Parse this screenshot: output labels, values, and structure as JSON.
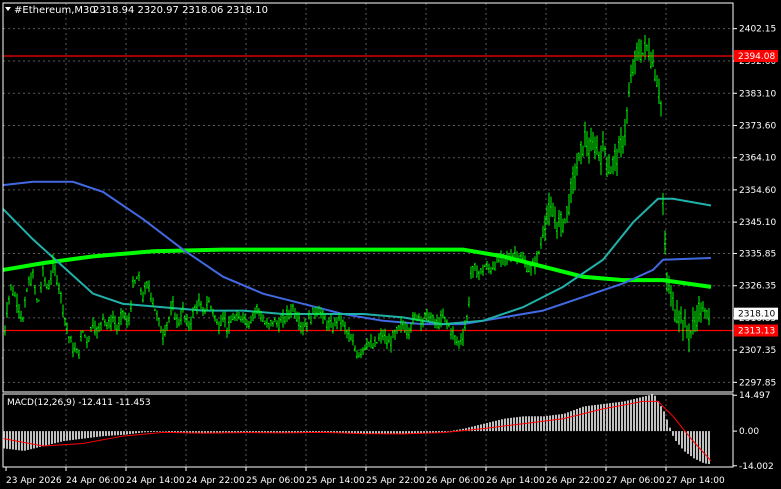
{
  "header": {
    "symbol_tf": "#Ethereum,M30",
    "ohlc": "2318.94 2320.97 2318.06 2318.10"
  },
  "macd": {
    "label": "MACD(12,26,9) -12.411 -11.453"
  },
  "colors": {
    "background": "#000000",
    "grid": "#5a5a5a",
    "candle": "#00ff00",
    "ma_slow": "#00ff00",
    "ma_blue": "#4169e1",
    "ma_teal": "#20b2aa",
    "hline": "#ff0000",
    "macd_hist": "#c0c0c0",
    "macd_signal": "#ff0000"
  },
  "chart_data": {
    "type": "candlestick",
    "symbol": "#Ethereum",
    "timeframe": "M30",
    "price_axis_ticks": [
      "2402.15",
      "2392.60",
      "2383.10",
      "2373.60",
      "2364.10",
      "2354.60",
      "2345.10",
      "2335.85",
      "2326.35",
      "2316.85",
      "2307.35",
      "2297.85"
    ],
    "price_range": [
      2295.0,
      2405.0
    ],
    "current_price": "2318.10",
    "hlines": [
      {
        "price": 2394.08,
        "label": "2394.08"
      },
      {
        "price": 2313.13,
        "label": "2313.13"
      }
    ],
    "time_axis_ticks": [
      "23 Apr 2026",
      "24 Apr 06:00",
      "24 Apr 14:00",
      "24 Apr 22:00",
      "25 Apr 06:00",
      "25 Apr 14:00",
      "25 Apr 22:00",
      "26 Apr 06:00",
      "26 Apr 14:00",
      "26 Apr 22:00",
      "27 Apr 06:00",
      "27 Apr 14:00"
    ],
    "price_series": [
      [
        0,
        2305
      ],
      [
        3,
        2318
      ],
      [
        8,
        2326
      ],
      [
        14,
        2322
      ],
      [
        20,
        2316
      ],
      [
        25,
        2327
      ],
      [
        30,
        2329
      ],
      [
        35,
        2320
      ],
      [
        40,
        2330
      ],
      [
        45,
        2325
      ],
      [
        50,
        2332
      ],
      [
        55,
        2328
      ],
      [
        60,
        2320
      ],
      [
        65,
        2312
      ],
      [
        70,
        2308
      ],
      [
        75,
        2306
      ],
      [
        80,
        2313
      ],
      [
        85,
        2310
      ],
      [
        90,
        2316
      ],
      [
        95,
        2312
      ],
      [
        100,
        2318
      ],
      [
        105,
        2314
      ],
      [
        110,
        2317
      ],
      [
        115,
        2313
      ],
      [
        120,
        2319
      ],
      [
        125,
        2314
      ],
      [
        130,
        2326
      ],
      [
        135,
        2329
      ],
      [
        140,
        2323
      ],
      [
        145,
        2327
      ],
      [
        150,
        2322
      ],
      [
        155,
        2316
      ],
      [
        160,
        2312
      ],
      [
        165,
        2316
      ],
      [
        170,
        2320
      ],
      [
        175,
        2315
      ],
      [
        180,
        2319
      ],
      [
        185,
        2314
      ],
      [
        190,
        2318
      ],
      [
        195,
        2322
      ],
      [
        200,
        2318
      ],
      [
        205,
        2322
      ],
      [
        210,
        2319
      ],
      [
        215,
        2314
      ],
      [
        220,
        2318
      ],
      [
        225,
        2313
      ],
      [
        230,
        2317
      ],
      [
        235,
        2316
      ],
      [
        240,
        2318
      ],
      [
        245,
        2315
      ],
      [
        250,
        2318
      ],
      [
        255,
        2320
      ],
      [
        260,
        2316
      ],
      [
        265,
        2314
      ],
      [
        270,
        2316
      ],
      [
        275,
        2315
      ],
      [
        280,
        2316
      ],
      [
        285,
        2318
      ],
      [
        290,
        2320
      ],
      [
        295,
        2317
      ],
      [
        300,
        2314
      ],
      [
        305,
        2316
      ],
      [
        310,
        2318
      ],
      [
        315,
        2320
      ],
      [
        320,
        2317
      ],
      [
        325,
        2315
      ],
      [
        330,
        2314
      ],
      [
        335,
        2317
      ],
      [
        340,
        2315
      ],
      [
        345,
        2312
      ],
      [
        350,
        2309
      ],
      [
        355,
        2306
      ],
      [
        360,
        2308
      ],
      [
        365,
        2310
      ],
      [
        370,
        2308
      ],
      [
        375,
        2310
      ],
      [
        380,
        2312
      ],
      [
        385,
        2309
      ],
      [
        390,
        2311
      ],
      [
        395,
        2313
      ],
      [
        400,
        2315
      ],
      [
        405,
        2313
      ],
      [
        410,
        2316
      ],
      [
        415,
        2318
      ],
      [
        420,
        2316
      ],
      [
        425,
        2318
      ],
      [
        430,
        2316
      ],
      [
        435,
        2315
      ],
      [
        440,
        2317
      ],
      [
        445,
        2315
      ],
      [
        450,
        2312
      ],
      [
        455,
        2309
      ],
      [
        460,
        2312
      ],
      [
        465,
        2318
      ],
      [
        468,
        2330
      ],
      [
        472,
        2331
      ],
      [
        477,
        2330
      ],
      [
        482,
        2332
      ],
      [
        487,
        2331
      ],
      [
        492,
        2333
      ],
      [
        497,
        2334
      ],
      [
        502,
        2334
      ],
      [
        507,
        2335
      ],
      [
        512,
        2336
      ],
      [
        517,
        2335
      ],
      [
        522,
        2333
      ],
      [
        527,
        2331
      ],
      [
        532,
        2333
      ],
      [
        537,
        2337
      ],
      [
        542,
        2346
      ],
      [
        547,
        2348
      ],
      [
        552,
        2346
      ],
      [
        557,
        2344
      ],
      [
        562,
        2346
      ],
      [
        567,
        2352
      ],
      [
        572,
        2360
      ],
      [
        577,
        2364
      ],
      [
        582,
        2370
      ],
      [
        587,
        2366
      ],
      [
        592,
        2368
      ],
      [
        597,
        2365
      ],
      [
        602,
        2367
      ],
      [
        607,
        2360
      ],
      [
        612,
        2364
      ],
      [
        617,
        2366
      ],
      [
        622,
        2372
      ],
      [
        627,
        2385
      ],
      [
        630,
        2390
      ],
      [
        635,
        2396
      ],
      [
        640,
        2395
      ],
      [
        645,
        2397
      ],
      [
        650,
        2392
      ],
      [
        655,
        2386
      ],
      [
        658,
        2380
      ],
      [
        660,
        2350
      ],
      [
        663,
        2330
      ],
      [
        667,
        2324
      ],
      [
        672,
        2319
      ],
      [
        677,
        2318
      ],
      [
        682,
        2314
      ],
      [
        687,
        2312
      ],
      [
        692,
        2316
      ],
      [
        697,
        2320
      ],
      [
        702,
        2318
      ],
      [
        707,
        2318
      ]
    ],
    "ma_series": [
      {
        "name": "",
        "color": "#00ff00",
        "points": [
          [
            0,
            2331
          ],
          [
            40,
            2333
          ],
          [
            90,
            2335
          ],
          [
            150,
            2336.5
          ],
          [
            220,
            2337
          ],
          [
            300,
            2337
          ],
          [
            380,
            2337
          ],
          [
            460,
            2337
          ],
          [
            500,
            2335
          ],
          [
            540,
            2332
          ],
          [
            580,
            2329
          ],
          [
            620,
            2328
          ],
          [
            660,
            2328
          ],
          [
            708,
            2326
          ]
        ]
      },
      {
        "name": "",
        "color": "#4169e1",
        "points": [
          [
            0,
            2356
          ],
          [
            30,
            2357
          ],
          [
            70,
            2357
          ],
          [
            100,
            2354
          ],
          [
            140,
            2346
          ],
          [
            180,
            2337
          ],
          [
            220,
            2329
          ],
          [
            260,
            2324
          ],
          [
            300,
            2321
          ],
          [
            340,
            2318
          ],
          [
            380,
            2316
          ],
          [
            420,
            2315
          ],
          [
            460,
            2315
          ],
          [
            500,
            2317
          ],
          [
            540,
            2319
          ],
          [
            580,
            2323
          ],
          [
            620,
            2327
          ],
          [
            650,
            2331
          ],
          [
            660,
            2334
          ],
          [
            708,
            2334.5
          ]
        ]
      },
      {
        "name": "",
        "color": "#20b2aa",
        "points": [
          [
            0,
            2349
          ],
          [
            30,
            2340
          ],
          [
            60,
            2332
          ],
          [
            90,
            2324
          ],
          [
            120,
            2321
          ],
          [
            160,
            2320
          ],
          [
            200,
            2319
          ],
          [
            240,
            2319
          ],
          [
            280,
            2318
          ],
          [
            320,
            2318
          ],
          [
            360,
            2318
          ],
          [
            400,
            2317
          ],
          [
            440,
            2315
          ],
          [
            480,
            2316
          ],
          [
            520,
            2320
          ],
          [
            560,
            2326
          ],
          [
            600,
            2334
          ],
          [
            630,
            2345
          ],
          [
            655,
            2352
          ],
          [
            670,
            2352
          ],
          [
            708,
            2350
          ]
        ]
      }
    ],
    "macd": {
      "name": "MACD(12,26,9)",
      "value": -12.411,
      "signal": -11.453,
      "axis_ticks": [
        "14.497",
        "0.00",
        "-14.002"
      ],
      "range": [
        -14.5,
        15.0
      ],
      "histogram": [
        [
          0,
          -7
        ],
        [
          20,
          -8
        ],
        [
          40,
          -6
        ],
        [
          60,
          -4
        ],
        [
          80,
          -3
        ],
        [
          100,
          -2
        ],
        [
          120,
          -1.5
        ],
        [
          140,
          -0.5
        ],
        [
          160,
          -0.2
        ],
        [
          180,
          -0.8
        ],
        [
          200,
          -1
        ],
        [
          220,
          -0.5
        ],
        [
          240,
          -0.8
        ],
        [
          260,
          -0.5
        ],
        [
          280,
          -0.8
        ],
        [
          300,
          -0.6
        ],
        [
          320,
          -0.4
        ],
        [
          340,
          -0.8
        ],
        [
          360,
          -1.2
        ],
        [
          380,
          -1
        ],
        [
          400,
          -1.2
        ],
        [
          420,
          -0.8
        ],
        [
          440,
          -0.4
        ],
        [
          460,
          1
        ],
        [
          480,
          3
        ],
        [
          500,
          5
        ],
        [
          520,
          6
        ],
        [
          540,
          6
        ],
        [
          560,
          7
        ],
        [
          580,
          10
        ],
        [
          600,
          11
        ],
        [
          620,
          12
        ],
        [
          640,
          14
        ],
        [
          650,
          15
        ],
        [
          660,
          8
        ],
        [
          670,
          -3
        ],
        [
          680,
          -8
        ],
        [
          690,
          -11
        ],
        [
          700,
          -13
        ],
        [
          708,
          -13.5
        ]
      ],
      "signal_line": [
        [
          0,
          -3
        ],
        [
          40,
          -6
        ],
        [
          80,
          -5
        ],
        [
          120,
          -2
        ],
        [
          160,
          -0.5
        ],
        [
          200,
          -0.8
        ],
        [
          240,
          -0.6
        ],
        [
          280,
          -0.7
        ],
        [
          320,
          -0.5
        ],
        [
          360,
          -1
        ],
        [
          400,
          -1.1
        ],
        [
          440,
          -0.6
        ],
        [
          480,
          1
        ],
        [
          520,
          3
        ],
        [
          560,
          5
        ],
        [
          600,
          9
        ],
        [
          640,
          12
        ],
        [
          655,
          12
        ],
        [
          670,
          6
        ],
        [
          690,
          -4
        ],
        [
          708,
          -12
        ]
      ]
    }
  }
}
